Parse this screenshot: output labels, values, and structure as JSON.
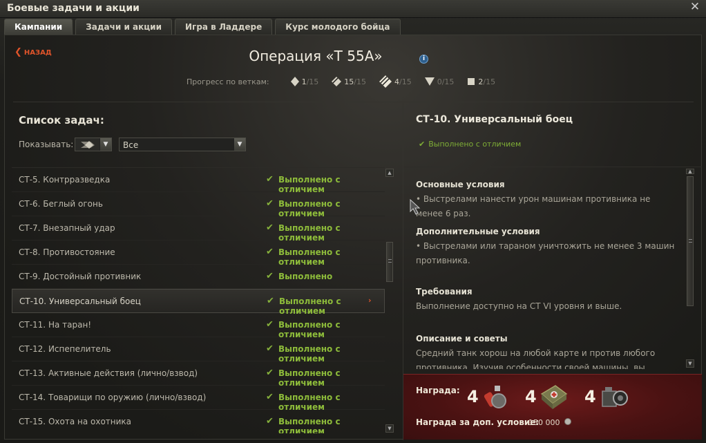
{
  "window": {
    "title": "Боевые задачи и акции",
    "close_glyph": "✕"
  },
  "tabs": [
    {
      "label": "Кампании",
      "active": true
    },
    {
      "label": "Задачи и акции",
      "active": false
    },
    {
      "label": "Игра в Ладдере",
      "active": false
    },
    {
      "label": "Курс молодого бойца",
      "active": false
    }
  ],
  "header": {
    "back_label": "НАЗАД",
    "operation_title": "Операция «Т 55А»",
    "info_glyph": "i",
    "progress_label": "Прогресс по веткам:",
    "branches": [
      {
        "icon": "heavy-tank-icon",
        "done": "1",
        "total": "/15"
      },
      {
        "icon": "medium-tank-icon",
        "done": "15",
        "total": "/15"
      },
      {
        "icon": "light-tank-icon",
        "done": "4",
        "total": "/15"
      },
      {
        "icon": "tank-destroyer-icon",
        "done": "0",
        "total": "/15"
      },
      {
        "icon": "spg-icon",
        "done": "2",
        "total": "/15"
      }
    ]
  },
  "left": {
    "list_title": "Список задач:",
    "show_label": "Показывать:",
    "filter_value": "Все",
    "tasks": [
      {
        "name": "СТ-5. Контрразведка",
        "status": "Выполнено с отличием",
        "selected": false
      },
      {
        "name": "СТ-6. Беглый огонь",
        "status": "Выполнено с отличием",
        "selected": false
      },
      {
        "name": "СТ-7. Внезапный удар",
        "status": "Выполнено с отличием",
        "selected": false
      },
      {
        "name": "СТ-8. Противостояние",
        "status": "Выполнено с отличием",
        "selected": false
      },
      {
        "name": "СТ-9. Достойный противник",
        "status": "Выполнено",
        "selected": false
      },
      {
        "name": "СТ-10. Универсальный боец",
        "status": "Выполнено с отличием",
        "selected": true
      },
      {
        "name": "СТ-11. На таран!",
        "status": "Выполнено с отличием",
        "selected": false
      },
      {
        "name": "СТ-12. Испепелитель",
        "status": "Выполнено с отличием",
        "selected": false
      },
      {
        "name": "СТ-13. Активные действия (лично/взвод)",
        "status": "Выполнено с отличием",
        "selected": false
      },
      {
        "name": "СТ-14. Товарищи по оружию (лично/взвод)",
        "status": "Выполнено с отличием",
        "selected": false
      },
      {
        "name": "СТ-15. Охота на охотника",
        "status": "Выполнено с отличием",
        "selected": false
      }
    ],
    "check_glyph": "✔",
    "selected_arrow": "›"
  },
  "right": {
    "title": "СТ-10. Универсальный боец",
    "status": "Выполнено с отличием",
    "sections": [
      {
        "heading": "Основные условия",
        "text": "• Выстрелами нанести урон машинам противника не менее 6 раз."
      },
      {
        "heading": "Дополнительные условия",
        "text": "• Выстрелами или тараном уничтожить не менее 3 машин противника."
      },
      {
        "heading": "Требования",
        "text": "Выполнение доступно на СТ VI уровня и выше."
      },
      {
        "heading": "Описание и советы",
        "text": "Средний танк хорош на любой карте и против любого противника. Изучив особенности своей машины, вы поймёте, как следует"
      }
    ],
    "reward": {
      "label": "Награда:",
      "items": [
        {
          "count": "4",
          "icon": "fire-extinguisher-icon"
        },
        {
          "count": "4",
          "icon": "medkit-icon"
        },
        {
          "count": "4",
          "icon": "repair-kit-icon"
        }
      ],
      "extra_label": "Награда за доп. условие:",
      "extra_value": "150 000",
      "extra_icon": "credits-icon"
    }
  },
  "colors": {
    "accent": "#e0542a",
    "status_green": "#8dbb3a",
    "reward_bg": "#4a1212"
  }
}
